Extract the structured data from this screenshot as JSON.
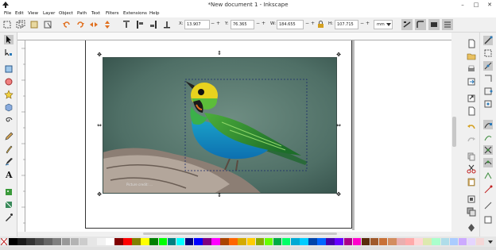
{
  "window": {
    "title": "*New document 1 - Inkscape",
    "minimize": "–",
    "maximize": "□",
    "close": "✕"
  },
  "menu": [
    "File",
    "Edit",
    "View",
    "Layer",
    "Object",
    "Path",
    "Text",
    "Filters",
    "Extensions",
    "Help"
  ],
  "tool_controls": {
    "x": {
      "label": "X:",
      "value": "13.907"
    },
    "y": {
      "label": "Y:",
      "value": "76.365"
    },
    "w": {
      "label": "W:",
      "value": "184.655"
    },
    "h": {
      "label": "H:",
      "value": "107.715"
    },
    "unit": "mm",
    "spin_minus": "−",
    "spin_plus": "+"
  },
  "image_watermark": "Picture credit: ...",
  "colors": {
    "accent": "#2c7ab8",
    "palette": [
      "#000000",
      "#1a1a1a",
      "#333333",
      "#4d4d4d",
      "#666666",
      "#808080",
      "#999999",
      "#b3b3b3",
      "#cccccc",
      "#e6e6e6",
      "#f2f2f2",
      "#ffffff",
      "#800000",
      "#ff0000",
      "#808000",
      "#ffff00",
      "#008000",
      "#00ff00",
      "#008080",
      "#00ffff",
      "#000080",
      "#0000ff",
      "#800080",
      "#ff00ff",
      "#aa4400",
      "#ff6600",
      "#d4aa00",
      "#ffcc00",
      "#88aa00",
      "#66ff00",
      "#00aa44",
      "#00ff66",
      "#00aad4",
      "#00ccff",
      "#0044aa",
      "#0066ff",
      "#4400aa",
      "#6600ff",
      "#aa0088",
      "#ff00cc",
      "#5a2d0c",
      "#a05a2c",
      "#c87137",
      "#d38d5f",
      "#e9afaf",
      "#ffaaaa",
      "#ffd5d5",
      "#dde9af",
      "#aaffcc",
      "#afdde9",
      "#aaccff",
      "#ccaaff",
      "#e5d5ff",
      "#f4d7d7"
    ]
  },
  "icons": {
    "toolbox": [
      "selector-arrow-icon",
      "node-tool-icon",
      "zoom-rectangle-icon",
      "rectangle-icon",
      "circle-icon",
      "star-icon",
      "3d-box-icon",
      "spiral-icon",
      "pencil-icon",
      "pen-icon",
      "calligraphy-icon",
      "text-icon",
      "spray-icon",
      "gradient-icon",
      "mesh-icon",
      "dropper-icon"
    ],
    "commands": [
      "new-doc-icon",
      "open-icon",
      "print-icon",
      "import-icon",
      "export-icon",
      "undo-icon",
      "redo-icon",
      "copy-icon",
      "cut-icon",
      "paste-icon",
      "zoom-icon",
      "duplicate-icon",
      "clone-icon",
      "group-icon"
    ],
    "snap": [
      "snap-enable-icon",
      "snap-bbox-icon",
      "snap-edge-icon",
      "snap-corner-icon",
      "snap-midpoint-icon",
      "snap-center-icon",
      "snap-nodes-icon",
      "snap-path-icon",
      "snap-intersection-icon",
      "snap-smooth-icon",
      "snap-cusp-icon",
      "snap-guide-icon",
      "snap-grid-icon",
      "snap-page-icon"
    ]
  }
}
